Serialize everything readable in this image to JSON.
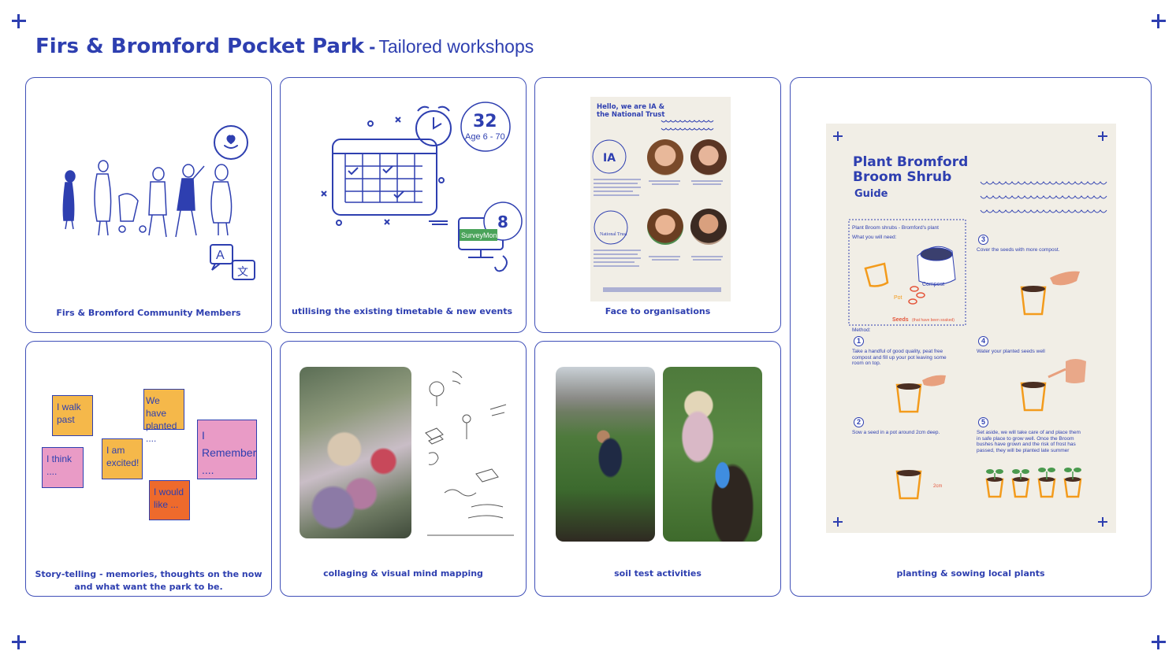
{
  "header": {
    "title": "Firs & Bromford Pocket Park",
    "separator": "-",
    "subtitle": "Tailored workshops"
  },
  "cards": {
    "community": {
      "caption": "Firs & Bromford Community Members",
      "translate_letter_a": "A",
      "translate_letter_b": "文"
    },
    "timetable": {
      "caption": "utilising the existing timetable & new events",
      "count_main": "32",
      "age_range": "Age 6 - 70",
      "count_survey": "8",
      "survey_label": "SurveyMonkey"
    },
    "organisations": {
      "caption": "Face to organisations",
      "poster_heading": "Hello, we are IA & the National Trust",
      "logo_ia": "IA",
      "logo_nt": "National Trust"
    },
    "storytelling": {
      "caption_line1": "Story-telling - memories, thoughts on the now",
      "caption_line2": "and what want the park to be.",
      "notes": {
        "walk": "I walk past",
        "planted": "We have planted ....",
        "think": "I think ....",
        "excited": "I am excited!",
        "remember": "I Remember ....",
        "would": "I would like ..."
      }
    },
    "collage": {
      "caption": "collaging & visual mind mapping"
    },
    "soil": {
      "caption": "soil test activities"
    },
    "planting": {
      "caption": "planting  & sowing local plants",
      "guide_title_1": "Plant Bromford",
      "guide_title_2": "Broom Shrub",
      "guide_sub": "Guide",
      "box_title": "Plant Broom shrubs - Bromford's plant",
      "box_need": "What you will need:",
      "label_pot": "Pot",
      "label_compost": "Compost",
      "label_seeds": "Seeds",
      "label_seeds_note": "(that have been soaked)",
      "method": "Method:",
      "step1_num": "1",
      "step1": "Take a handful of good quality, peat free compost and fill up your pot leaving some room on top.",
      "step2_num": "2",
      "step2": "Sow a seed in a pot around 2cm deep.",
      "step3_num": "3",
      "step3": "Cover the seeds with more compost.",
      "step4_num": "4",
      "step4": "Water your planted seeds well",
      "step5_num": "5",
      "step5": "Set aside, we will take care of and place them in safe place to grow well. Once the Broom bushes have grown and the risk of frost has passed, they will be planted late summer",
      "depth_label": "2cm"
    }
  },
  "colors": {
    "brand_blue": "#2e3fb0",
    "note_yellow": "#f5b84a",
    "note_pink": "#e99bc6",
    "note_orange": "#ee6a2c",
    "pot_orange": "#f39b1c",
    "guide_bg": "#f1eee6"
  },
  "icons": [
    "plus-icon",
    "heart-hand-icon",
    "translate-icon",
    "calendar-icon",
    "alarm-clock-icon",
    "computer-icon",
    "sparkle-icon"
  ]
}
